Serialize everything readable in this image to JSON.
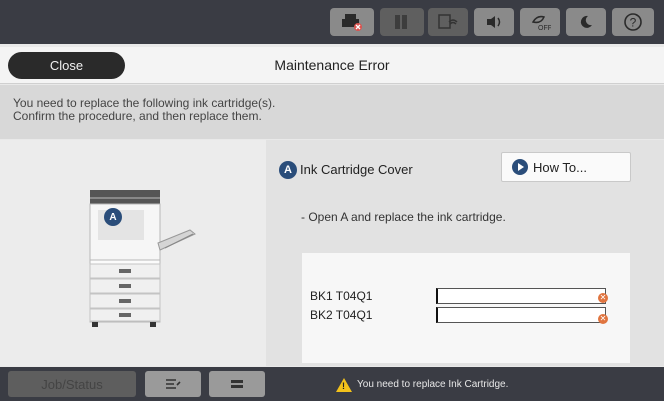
{
  "statusbar": {
    "icons": [
      "printer-error-icon",
      "ink-icon",
      "wifi-icon",
      "volume-icon",
      "eco-icon",
      "sleep-icon",
      "help-icon"
    ]
  },
  "header": {
    "close_label": "Close",
    "title": "Maintenance Error"
  },
  "message": {
    "line1": "You need to replace the following ink cartridge(s).",
    "line2": "Confirm the procedure, and then replace them."
  },
  "diagram": {
    "marker": "A"
  },
  "instructions": {
    "cover_badge": "A",
    "cover_label": "Ink Cartridge Cover",
    "howto_label": "How To...",
    "text": "- Open A and replace the ink cartridge."
  },
  "cartridges": [
    {
      "name": "BK1  T04Q1",
      "level": 0.0,
      "status": "error"
    },
    {
      "name": "BK2  T04Q1",
      "level": 0.0,
      "status": "error"
    }
  ],
  "bottombar": {
    "job_status_label": "Job/Status",
    "warning_text": "You need to replace Ink Cartridge."
  },
  "colors": {
    "accent": "#2a4d7a",
    "error": "#e0743f",
    "warning": "#f3c21b"
  }
}
